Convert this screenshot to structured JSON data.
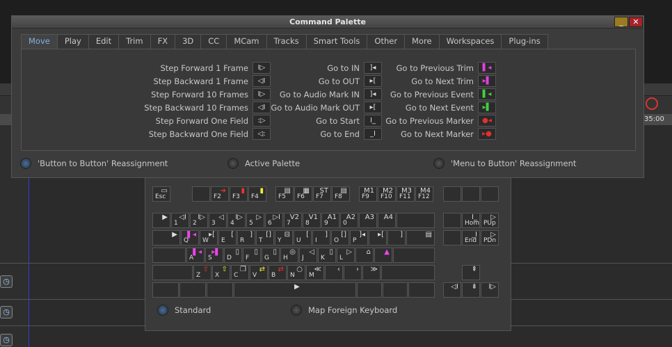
{
  "window": {
    "title": "Command Palette",
    "min_label": "_",
    "close_label": "✕"
  },
  "tabs": [
    "Move",
    "Play",
    "Edit",
    "Trim",
    "FX",
    "3D",
    "CC",
    "MCam",
    "Tracks",
    "Smart Tools",
    "Other",
    "More",
    "Workspaces",
    "Plug-ins"
  ],
  "commands": {
    "col1": [
      {
        "label": "Step Forward 1 Frame",
        "icon": "I▷"
      },
      {
        "label": "Step Backward 1 Frame",
        "icon": "◁I"
      },
      {
        "label": "Step Forward 10 Frames",
        "icon": "I▷"
      },
      {
        "label": "Step Backward 10 Frames",
        "icon": "◁I"
      },
      {
        "label": "Step Forward One Field",
        "icon": ":▷"
      },
      {
        "label": "Step Backward One Field",
        "icon": "◁:"
      }
    ],
    "col2": [
      {
        "label": "Go to IN",
        "icon": "]◂"
      },
      {
        "label": "Go to OUT",
        "icon": "▸["
      },
      {
        "label": "Go to Audio Mark IN",
        "icon": "]◂"
      },
      {
        "label": "Go to Audio Mark OUT",
        "icon": "▸["
      },
      {
        "label": "Go to Start",
        "icon": "I_"
      },
      {
        "label": "Go to End",
        "icon": "_I"
      }
    ],
    "col3": [
      {
        "label": "Go to Previous Trim",
        "icon": "▌◂"
      },
      {
        "label": "Go to Next Trim",
        "icon": "▸▌"
      },
      {
        "label": "Go to Previous Event",
        "icon": "▌◂"
      },
      {
        "label": "Go to Next Event",
        "icon": "▸▌"
      },
      {
        "label": "Go to Previous  Marker",
        "icon": "●◂"
      },
      {
        "label": "Go to Next Marker",
        "icon": "▸●"
      }
    ]
  },
  "options": {
    "button_to_button": "'Button to Button' Reassignment",
    "active_palette": "Active Palette",
    "menu_to_button": "'Menu to Button' Reassignment"
  },
  "keyboard": {
    "standard": "Standard",
    "map_foreign": "Map Foreign Keyboard",
    "keys": {
      "esc": "Esc",
      "f2": "F2",
      "f3": "F3",
      "f4": "F4",
      "f5": "F5",
      "f6": "F6",
      "f7": "F7",
      "f8": "F8",
      "f9": "F9",
      "f10": "F10",
      "f11": "F11",
      "f12": "F12",
      "m1": "M1",
      "m2": "M2",
      "m3": "M3",
      "m4": "M4",
      "st": "ST",
      "hom": "Hom",
      "pup": "PUp",
      "end": "End",
      "pdn": "PDn",
      "v2": "V2",
      "v1": "V1",
      "a1": "A1",
      "a2": "A2",
      "a3": "A3",
      "a4": "A4",
      "n1": "1",
      "n2": "2",
      "n3": "3",
      "n4": "4",
      "n5": "5",
      "n6": "6",
      "n7": "7",
      "n8": "8",
      "n9": "9",
      "n0": "0",
      "q": "Q",
      "w": "W",
      "e": "E",
      "r": "R",
      "t": "T",
      "y": "Y",
      "u": "U",
      "i": "I",
      "o": "O",
      "p": "P",
      "a": "A",
      "s": "S",
      "d": "D",
      "f": "F",
      "g": "G",
      "h": "H",
      "j": "J",
      "k": "K",
      "l": "L",
      "z": "Z",
      "x": "X",
      "c": "C",
      "v": "V",
      "b": "B",
      "n": "N",
      "m": "M"
    }
  },
  "background": {
    "timecode": "35:00"
  },
  "colors": {
    "accent": "#7fb0e8",
    "close": "#a5242a",
    "minimize": "#9b7b20"
  }
}
